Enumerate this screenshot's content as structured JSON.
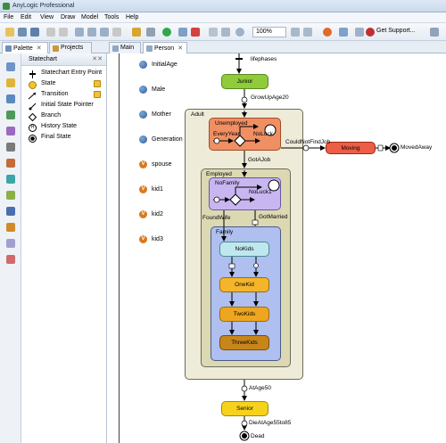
{
  "window": {
    "title": "AnyLogic Professional"
  },
  "menu": [
    "File",
    "Edit",
    "View",
    "Draw",
    "Model",
    "Tools",
    "Help"
  ],
  "toolbar": {
    "zoom_value": "100%",
    "support_label": "Get Support..."
  },
  "tabs": {
    "palette": "Palette",
    "projects": "Projects",
    "main": "Main",
    "person": "Person"
  },
  "palette": {
    "section_title": "Statechart",
    "items": [
      {
        "label": "Statechart Entry Point",
        "icon": "entry-point-icon"
      },
      {
        "label": "State",
        "icon": "state-icon"
      },
      {
        "label": "Transition",
        "icon": "transition-icon"
      },
      {
        "label": "Initial State Pointer",
        "icon": "initial-pointer-icon"
      },
      {
        "label": "Branch",
        "icon": "branch-icon"
      },
      {
        "label": "History State",
        "icon": "history-icon"
      },
      {
        "label": "Final State",
        "icon": "final-state-icon"
      }
    ]
  },
  "parameters": [
    "InitialAge",
    "Male",
    "Mother",
    "Generation"
  ],
  "variables": [
    "spouse",
    "kid1",
    "kid2",
    "kid3"
  ],
  "statechart": {
    "entry": "lifephases",
    "states": {
      "junior": "Junior",
      "adult": "Adult",
      "unemployed": "Unemployed",
      "every_year": "EveryYear",
      "no_luck": "NoLuck",
      "employed": "Employed",
      "no_family": "NoFamily",
      "no_luck1": "NoLuck1",
      "family": "Family",
      "no_kids": "NoKids",
      "one_kid": "OneKid",
      "two_kids": "TwoKids",
      "three_kids": "ThreeKids",
      "moving": "Moving",
      "senior": "Senior",
      "dead": "Dead",
      "moved_away": "MovedAway"
    },
    "transitions": {
      "grow_up": "GrowUpAge20",
      "could_not_find_job": "CouldNotFindJob",
      "got_a_job": "GotAJob",
      "found_wife": "FoundWife",
      "got_married": "GotMarried",
      "at_age_50": "AtAge50",
      "die": "DieAtAge55to85"
    }
  },
  "colors": {
    "junior": "#8fcb3a",
    "unemployed": "#f08f64",
    "moving": "#ec5e46",
    "no_family": "#c7b6f0",
    "no_kids": "#bfe8ee",
    "kid_states": "#f5b52a",
    "three_kids": "#c8861a",
    "senior": "#f7d21c",
    "adult_fill": "#eeebd9",
    "employed_fill": "#dcd8b2",
    "family_fill": "#aebff0"
  }
}
